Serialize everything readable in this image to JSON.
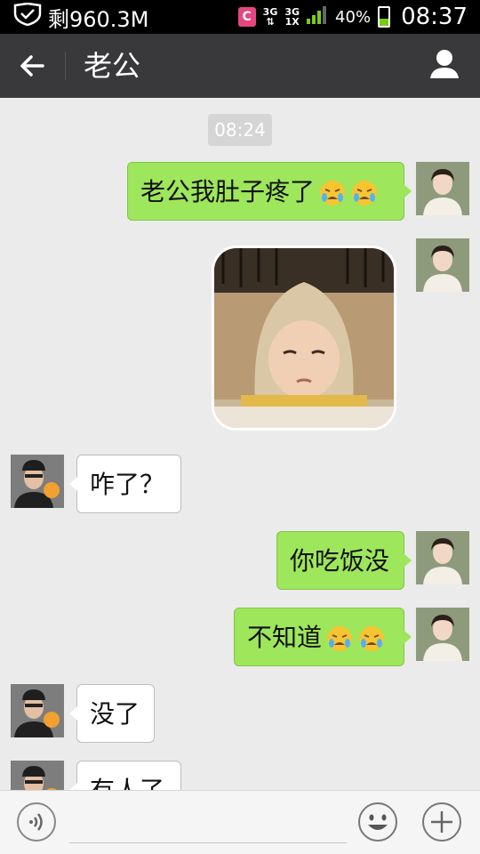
{
  "status_bar": {
    "storage_text": "剩960.3M",
    "app_badge": "C",
    "network_1": "3G",
    "network_2_top": "3G",
    "network_2_bottom": "1X",
    "battery_percent": "40%",
    "battery_level": 0.4,
    "time": "08:37"
  },
  "title_bar": {
    "title": "老公"
  },
  "chat": {
    "timestamp": "08:24",
    "messages": [
      {
        "side": "self",
        "type": "text",
        "text": "老公我肚子疼了",
        "emoji": [
          "crying-face",
          "crying-face"
        ]
      },
      {
        "side": "self",
        "type": "sticker",
        "sticker": "baby-in-hood"
      },
      {
        "side": "other",
        "type": "text",
        "text": "咋了？"
      },
      {
        "side": "self",
        "type": "text",
        "text": "你吃饭没"
      },
      {
        "side": "self",
        "type": "text",
        "text": "不知道",
        "emoji": [
          "crying-face",
          "crying-face"
        ]
      },
      {
        "side": "other",
        "type": "text",
        "text": "没了"
      },
      {
        "side": "other",
        "type": "text",
        "text": "有人了"
      }
    ]
  },
  "icons": {
    "back": "arrow-left-icon",
    "profile": "person-icon",
    "voice": "voice-icon",
    "emoji": "smiley-icon",
    "more": "plus-icon"
  },
  "colors": {
    "outgoing_bubble": "#9ee65b",
    "incoming_bubble": "#ffffff",
    "title_bar": "#39393b",
    "chat_background": "#ebebeb"
  }
}
